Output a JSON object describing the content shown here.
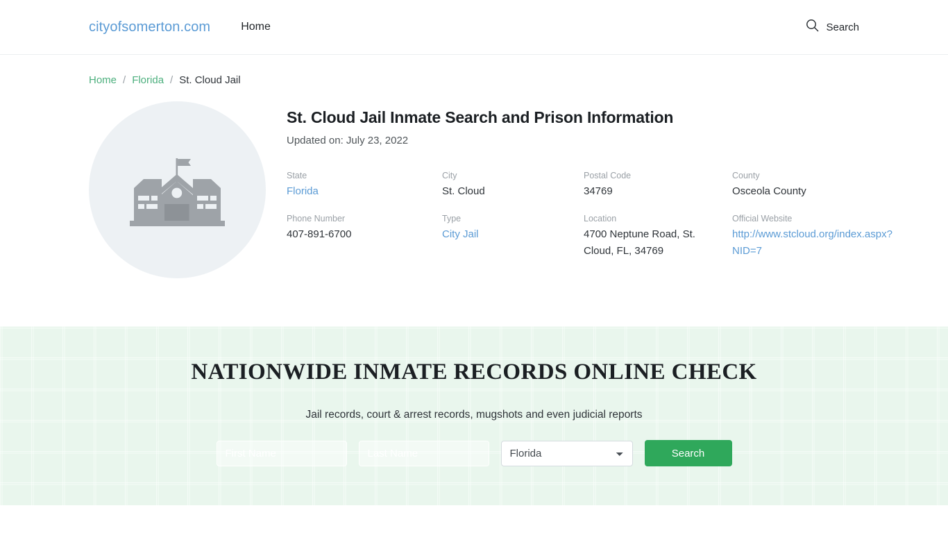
{
  "header": {
    "brand": "cityofsomerton.com",
    "nav": [
      {
        "label": "Home"
      }
    ],
    "search_label": "Search"
  },
  "breadcrumb": {
    "items": [
      {
        "label": "Home",
        "type": "link"
      },
      {
        "label": "Florida",
        "type": "link"
      },
      {
        "label": "St. Cloud Jail",
        "type": "current"
      }
    ],
    "separator": "/"
  },
  "facility": {
    "icon": "government-building-icon",
    "title": "St. Cloud Jail Inmate Search and Prison Information",
    "updated": "Updated on: July 23, 2022",
    "fields": [
      {
        "label": "State",
        "value": "Florida",
        "is_link": true
      },
      {
        "label": "City",
        "value": "St. Cloud",
        "is_link": false
      },
      {
        "label": "Postal Code",
        "value": "34769",
        "is_link": false
      },
      {
        "label": "County",
        "value": "Osceola County",
        "is_link": false
      },
      {
        "label": "Phone Number",
        "value": "407-891-6700",
        "is_link": false
      },
      {
        "label": "Type",
        "value": "City Jail",
        "is_link": true
      },
      {
        "label": "Location",
        "value": "4700 Neptune Road, St. Cloud, FL, 34769",
        "is_link": false
      },
      {
        "label": "Official Website",
        "value": "http://www.stcloud.org/index.aspx?NID=7",
        "is_link": true
      }
    ]
  },
  "promo": {
    "title": "NATIONWIDE INMATE RECORDS ONLINE CHECK",
    "subtitle": "Jail records, court & arrest records, mugshots and even judicial reports",
    "first_name_placeholder": "First Name",
    "first_name_value": "",
    "last_name_placeholder": "Last Name",
    "last_name_value": "",
    "state_selected": "Florida",
    "state_options": [
      "Florida"
    ],
    "search_button": "Search"
  },
  "colors": {
    "brand_blue": "#5b9bd5",
    "crumb_green": "#4caf7d",
    "button_green": "#2fa85b",
    "banner_bg": "#e9f6ed",
    "thumb_bg": "#edf1f4"
  }
}
